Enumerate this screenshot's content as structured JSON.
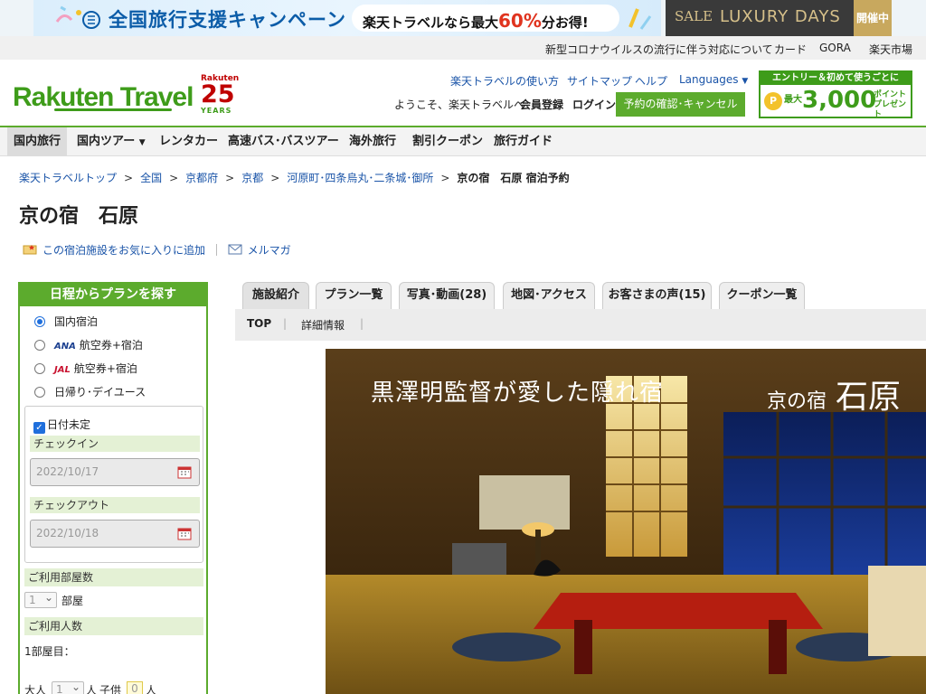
{
  "banner": {
    "campaign": "全国旅行支援キャンペーン",
    "pill_prefix": "楽天トラベルなら最大",
    "pill_pct": "60%",
    "pill_suffix": "分お得!",
    "sale": "SALE",
    "luxury": "LUXURY DAYS",
    "open": "開催中"
  },
  "utility": [
    "新型コロナウイルスの流行に伴う対応について",
    "カード",
    "GORA",
    "楽天市場"
  ],
  "header": {
    "logo": "Rakuten Travel",
    "anniv_brand": "Rakuten",
    "anniv_num": "25",
    "anniv_years": "YEARS",
    "links": [
      "楽天トラベルの使い方",
      "サイトマップ",
      "ヘルプ",
      "Languages"
    ],
    "welcome": "ようこそ、楽天トラベルへ",
    "register": "会員登録",
    "login": "ログイン",
    "reservation": "予約の確認･キャンセル",
    "promo_top": "エントリー＆初めて使うごとに",
    "promo_coin": "P",
    "promo_max": "最大",
    "promo_amount": "3,000",
    "promo_pt1": "ポイント",
    "promo_pt2": "プレゼント"
  },
  "nav": [
    "国内旅行",
    "国内ツアー",
    "レンタカー",
    "高速バス･バスツアー",
    "海外旅行",
    "割引クーポン",
    "旅行ガイド"
  ],
  "breadcrumb": [
    "楽天トラベルトップ",
    "全国",
    "京都府",
    "京都",
    "河原町･四条烏丸･二条城･御所",
    "京の宿　石原 宿泊予約"
  ],
  "hotel": {
    "title": "京の宿　石原",
    "fav": "この宿泊施設をお気に入りに追加",
    "mail": "メルマガ"
  },
  "search": {
    "title": "日程からプランを探す",
    "options": [
      {
        "airline": "",
        "label": "国内宿泊"
      },
      {
        "airline": "ANA",
        "label": "航空券+宿泊"
      },
      {
        "airline": "JAL",
        "label": "航空券+宿泊"
      },
      {
        "airline": "",
        "label": "日帰り･デイユース"
      }
    ],
    "date_undecided": "日付未定",
    "checkin_label": "チェックイン",
    "checkin": "2022/10/17",
    "checkout_label": "チェックアウト",
    "checkout": "2022/10/18",
    "rooms_label": "ご利用部屋数",
    "rooms_value": "1",
    "rooms_unit": "部屋",
    "people_label": "ご利用人数",
    "room1": "1部屋目：",
    "adult_label": "大人",
    "adult_value": "1",
    "person_unit": "人",
    "child_label": "子供",
    "child_value": "0"
  },
  "tabs": [
    "施設紹介",
    "プラン一覧",
    "写真･動画(28)",
    "地図･アクセス",
    "お客さまの声(15)",
    "クーポン一覧"
  ],
  "subtabs": [
    "TOP",
    "詳細情報"
  ],
  "hero": {
    "caption": "黒澤明監督が愛した隠れ宿",
    "name_small": "京の宿",
    "name_big": "石原"
  },
  "colors": {
    "brand_green": "#5cab2d",
    "link_blue": "#1a54a8",
    "sale_red": "#e0341f"
  }
}
